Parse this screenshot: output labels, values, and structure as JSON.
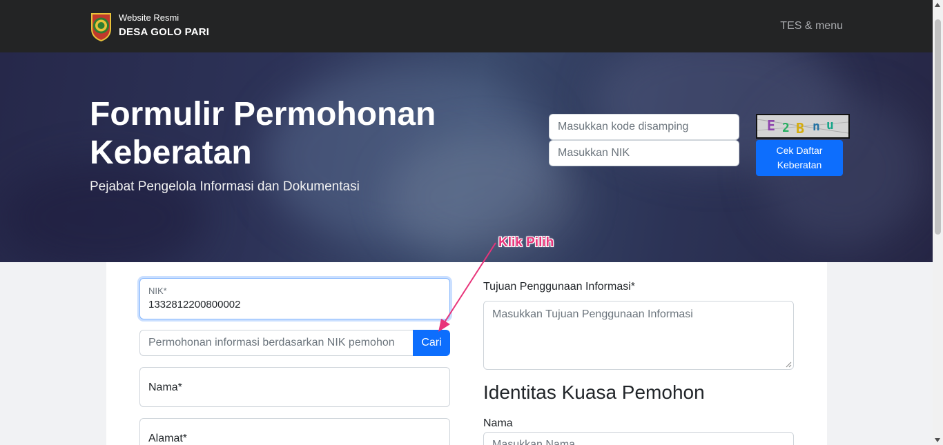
{
  "header": {
    "brand_small": "Website Resmi",
    "brand_big": "DESA GOLO PARI",
    "menu_label": "TES & menu"
  },
  "hero": {
    "title": "Formulir Permohonan Keberatan",
    "subtitle": "Pejabat Pengelola Informasi dan Dokumentasi",
    "captcha_input_placeholder": "Masukkan kode disamping",
    "nik_input_placeholder": "Masukkan NIK",
    "captcha_text": "E2Bnu",
    "cek_button": "Cek Daftar Keberatan"
  },
  "form": {
    "nik_label": "NIK*",
    "nik_value": "1332812200800002",
    "search_placeholder": "Permohonan informasi berdasarkan NIK pemohon",
    "cari_button": "Cari",
    "nama_placeholder": "Nama*",
    "alamat_placeholder": "Alamat*",
    "tujuan_label": "Tujuan Penggunaan Informasi*",
    "tujuan_placeholder": "Masukkan Tujuan Penggunaan Informasi",
    "kuasa_heading": "Identitas Kuasa Pemohon",
    "kuasa_nama_label": "Nama",
    "kuasa_nama_placeholder": "Masukkan Nama"
  },
  "annotation": {
    "text": "Klik Pilih"
  },
  "colors": {
    "primary": "#0d6efd",
    "navbar": "#232425",
    "annotation": "#e8347a"
  }
}
